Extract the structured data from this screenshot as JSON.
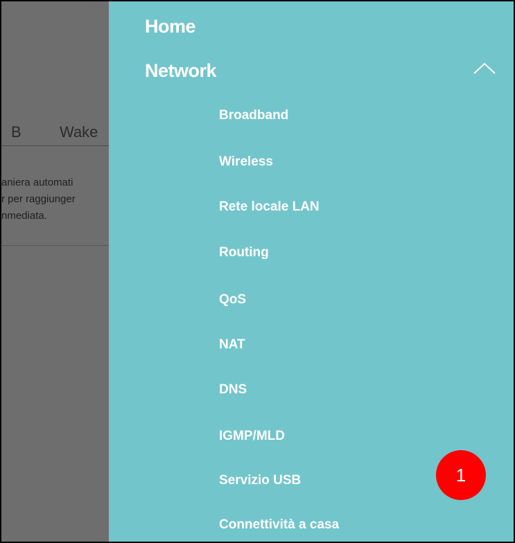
{
  "background": {
    "tabs": [
      "B",
      "Wake"
    ],
    "text_lines": [
      "aniera automati",
      "r per raggiunger",
      "nmediata."
    ]
  },
  "menu": {
    "home_label": "Home",
    "network_label": "Network",
    "network_expanded_icon": "chevron-up-icon",
    "sub_items": [
      "Broadband",
      "Wireless",
      "Rete locale LAN",
      "Routing",
      "QoS",
      "NAT",
      "DNS",
      "IGMP/MLD",
      "Servizio USB",
      "Connettività a casa"
    ]
  },
  "annotation": {
    "label": "1",
    "color": "#ff0000"
  },
  "colors": {
    "drawer_bg": "#72c5cb",
    "menu_text": "#ffffff",
    "overlay": "#6e6e6e"
  }
}
